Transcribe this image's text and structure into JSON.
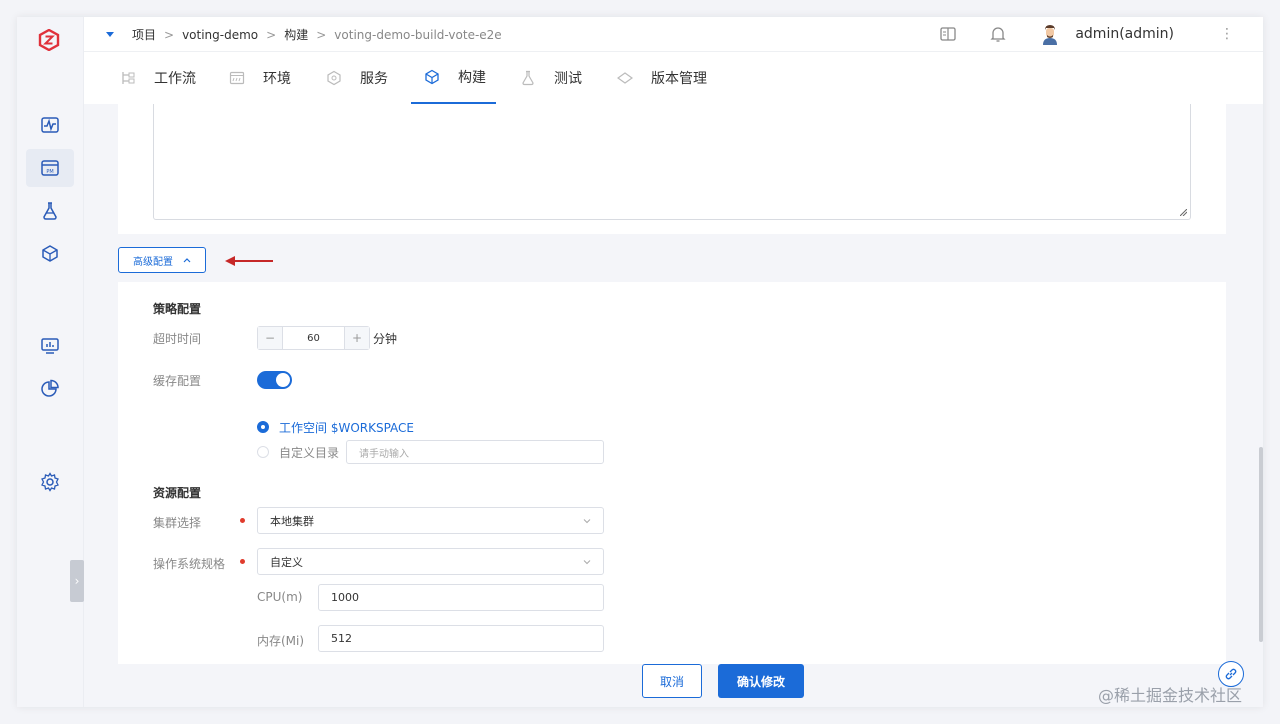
{
  "breadcrumb": {
    "items": [
      "项目",
      "voting-demo",
      "构建",
      "voting-demo-build-vote-e2e"
    ],
    "separator": ">"
  },
  "user": {
    "name": "admin(admin)"
  },
  "tabs": [
    {
      "label": "工作流",
      "icon": "workflow-icon"
    },
    {
      "label": "环境",
      "icon": "environment-icon"
    },
    {
      "label": "服务",
      "icon": "service-icon"
    },
    {
      "label": "构建",
      "icon": "build-icon",
      "active": true
    },
    {
      "label": "测试",
      "icon": "test-icon"
    },
    {
      "label": "版本管理",
      "icon": "version-icon"
    }
  ],
  "advanced": {
    "label": "高级配置"
  },
  "strategy": {
    "title": "策略配置",
    "timeout_label": "超时时间",
    "timeout_value": "60",
    "timeout_unit": "分钟",
    "timeout_minus": "−",
    "timeout_plus": "+",
    "cache_label": "缓存配置",
    "cache_enabled": true,
    "cache_option_workspace": "工作空间 $WORKSPACE",
    "cache_option_custom": "自定义目录",
    "custom_dir_placeholder": "请手动输入"
  },
  "resource": {
    "title": "资源配置",
    "cluster_label": "集群选择",
    "cluster_value": "本地集群",
    "os_label": "操作系统规格",
    "os_value": "自定义",
    "cpu_label": "CPU(m)",
    "cpu_value": "1000",
    "mem_label": "内存(Mi)",
    "mem_value": "512"
  },
  "footer": {
    "cancel": "取消",
    "confirm": "确认修改"
  },
  "watermark": "@稀土掘金技术社区",
  "colors": {
    "primary": "#1b6bd8",
    "required": "#e03b2c",
    "annotation_arrow": "#c62828"
  }
}
